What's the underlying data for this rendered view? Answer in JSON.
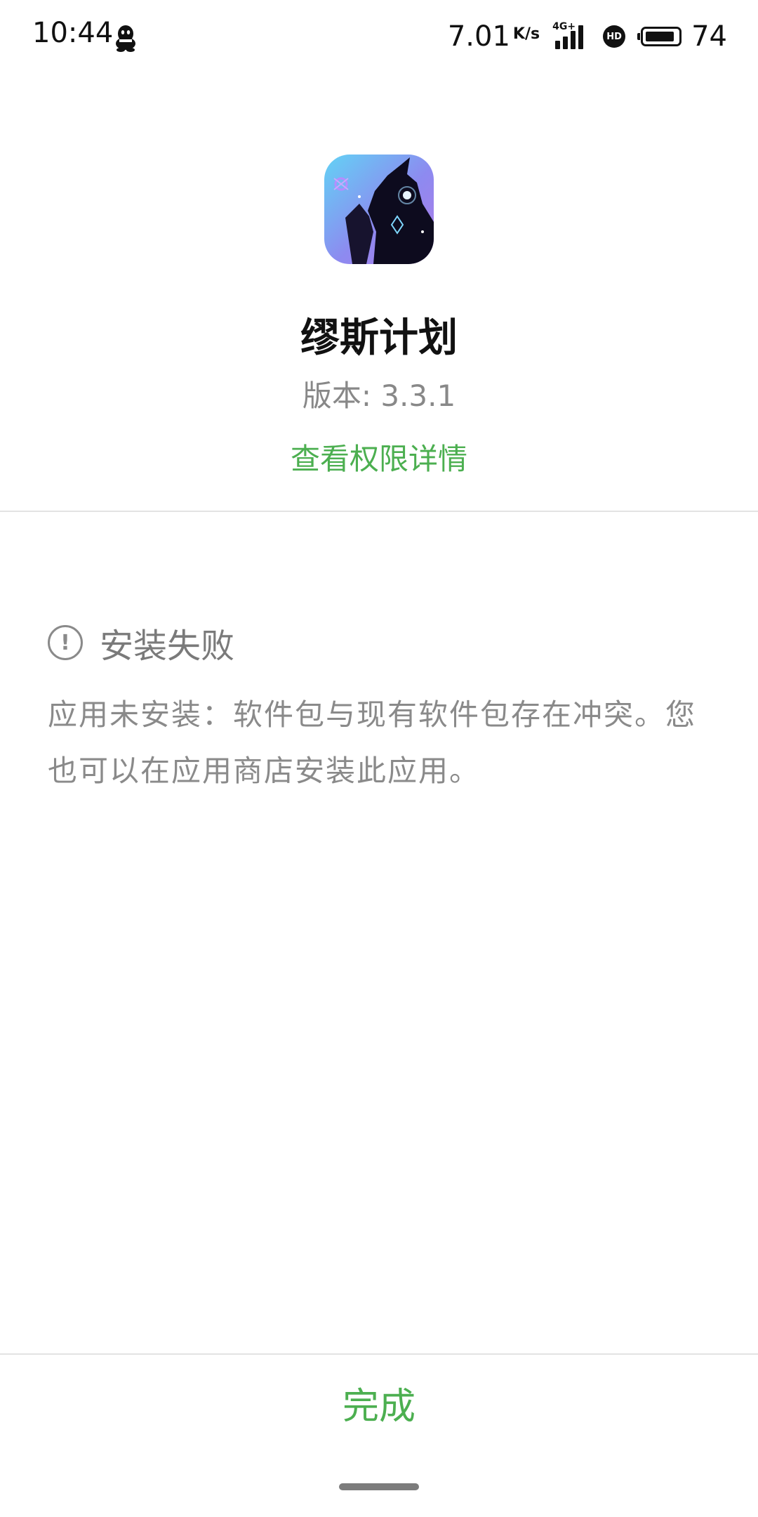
{
  "status_bar": {
    "time": "10:44",
    "net_speed": "7.01",
    "net_speed_unit": "K/s",
    "network_type": "4G+",
    "hd_label": "HD",
    "battery_percent": "74",
    "icons": [
      "qq-icon",
      "signal-icon",
      "hd-icon",
      "battery-icon"
    ]
  },
  "app": {
    "name": "缪斯计划",
    "version": "版本: 3.3.1",
    "permission_link": "查看权限详情"
  },
  "result": {
    "title": "安装失败",
    "message": "应用未安装：软件包与现有软件包存在冲突。您也可以在应用商店安装此应用。",
    "icon": "exclamation-circle-icon"
  },
  "footer": {
    "done_label": "完成"
  },
  "colors": {
    "accent": "#4caf50",
    "muted_text": "#8a8a8a",
    "divider": "#e3e3e3"
  }
}
